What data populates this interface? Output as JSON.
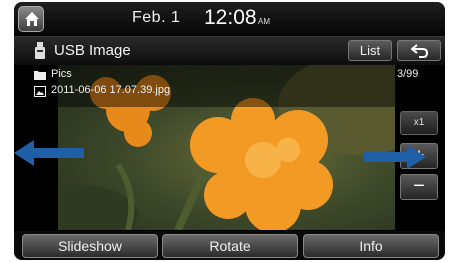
{
  "status_bar": {
    "home_icon": "home-icon",
    "date": "Feb.  1",
    "time": "12:08",
    "ampm": "AM"
  },
  "title_bar": {
    "source_icon": "usb-icon",
    "source_title": "USB Image",
    "list_label": "List",
    "back_icon": "back-arrow-icon"
  },
  "file_info": {
    "folder_icon": "folder-icon",
    "folder_name": "Pics",
    "file_icon": "image-file-icon",
    "file_name": "2011-06-06 17.07.39.jpg",
    "counter": "3/99"
  },
  "zoom_controls": {
    "level": "x1",
    "zoom_in_label": "+",
    "zoom_out_label": "−"
  },
  "navigation": {
    "prev_icon": "left-arrow-icon",
    "next_icon": "right-arrow-icon",
    "arrow_color": "#1f5fa8"
  },
  "bottom_buttons": [
    {
      "label": "Slideshow"
    },
    {
      "label": "Rotate"
    },
    {
      "label": "Info"
    }
  ]
}
